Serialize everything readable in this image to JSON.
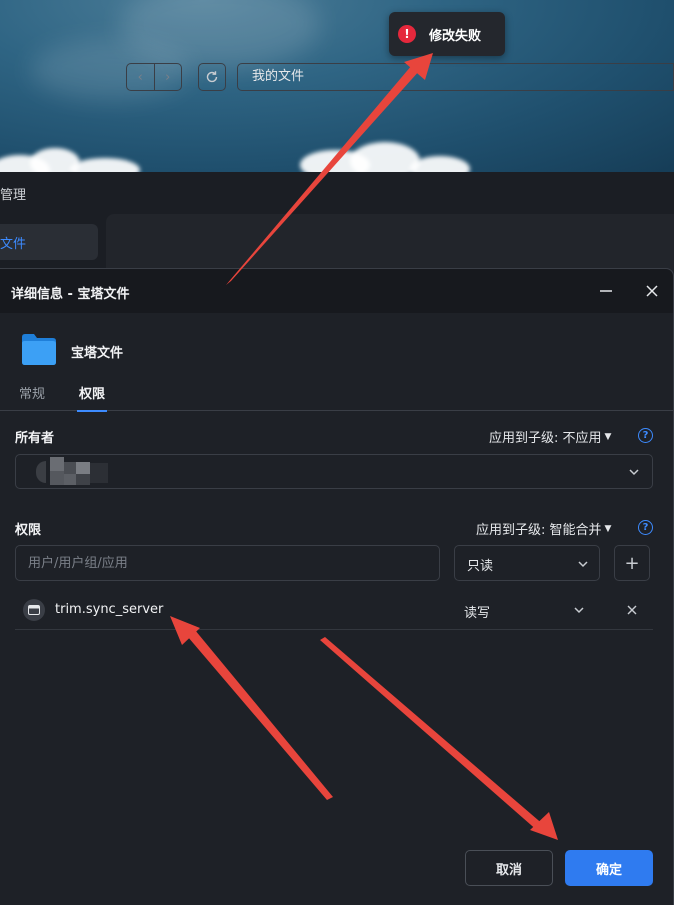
{
  "toast": {
    "message": "修改失败",
    "icon": "error-icon",
    "color": "#e5283c"
  },
  "app": {
    "title": "管理",
    "sidebar_item": "文件",
    "path": "我的文件"
  },
  "dialog": {
    "title": "详细信息 - 宝塔文件",
    "folder_name": "宝塔文件",
    "tabs": [
      {
        "label": "常规"
      },
      {
        "label": "权限",
        "active": true
      }
    ],
    "owner": {
      "label": "所有者",
      "apply_label": "应用到子级: 不应用"
    },
    "permissions": {
      "label": "权限",
      "apply_label": "应用到子级: 智能合并",
      "input_placeholder": "用户/用户组/应用",
      "select_value": "只读",
      "entries": [
        {
          "name": "trim.sync_server",
          "permission": "读写"
        }
      ]
    },
    "buttons": {
      "cancel": "取消",
      "ok": "确定"
    }
  },
  "colors": {
    "accent": "#3d8bff",
    "primary_button": "#2f7bf0",
    "annotation_arrow": "#e8453c"
  }
}
